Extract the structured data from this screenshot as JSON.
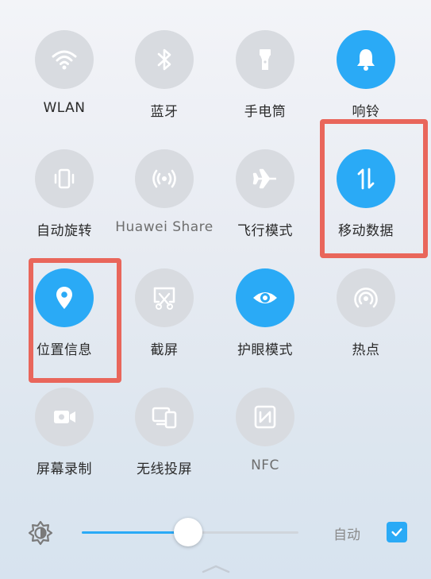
{
  "tiles": [
    {
      "label": "WLAN",
      "icon": "wifi-icon",
      "on": false
    },
    {
      "label": "蓝牙",
      "icon": "bluetooth-icon",
      "on": false
    },
    {
      "label": "手电筒",
      "icon": "flashlight-icon",
      "on": false
    },
    {
      "label": "响铃",
      "icon": "bell-icon",
      "on": true
    },
    {
      "label": "自动旋转",
      "icon": "auto-rotate-icon",
      "on": false
    },
    {
      "label": "Huawei Share",
      "icon": "huawei-share-icon",
      "on": false
    },
    {
      "label": "飞行模式",
      "icon": "airplane-icon",
      "on": false
    },
    {
      "label": "移动数据",
      "icon": "mobile-data-icon",
      "on": true
    },
    {
      "label": "位置信息",
      "icon": "location-pin-icon",
      "on": true
    },
    {
      "label": "截屏",
      "icon": "screenshot-icon",
      "on": false
    },
    {
      "label": "护眼模式",
      "icon": "eye-icon",
      "on": true
    },
    {
      "label": "热点",
      "icon": "hotspot-icon",
      "on": false
    },
    {
      "label": "屏幕录制",
      "icon": "screen-record-icon",
      "on": false
    },
    {
      "label": "无线投屏",
      "icon": "wireless-projection-icon",
      "on": false
    },
    {
      "label": "NFC",
      "icon": "nfc-icon",
      "on": false
    }
  ],
  "highlighted_tiles": [
    "移动数据",
    "位置信息"
  ],
  "brightness": {
    "level_percent": 49,
    "auto_label": "自动",
    "auto_checked": true
  },
  "colors": {
    "accent": "#2aaaf6",
    "inactive": "#d8dbe0",
    "highlight": "#e9665b"
  }
}
